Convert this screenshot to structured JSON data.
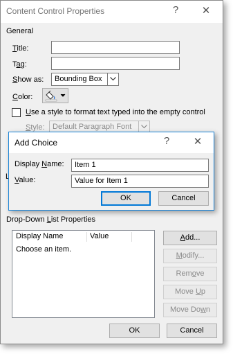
{
  "dialog": {
    "title": "Content Control Properties",
    "help_glyph": "?",
    "close_glyph": "✕",
    "general": {
      "heading": "General",
      "title_label": {
        "key": "T",
        "rest": "itle:"
      },
      "title_value": "",
      "tag_label": {
        "key": "T",
        "rest": "ag:"
      },
      "tag_value": "",
      "show_as_label": {
        "key": "S",
        "rest": "how as:"
      },
      "show_as_value": "Bounding Box",
      "color_label": {
        "key": "C",
        "rest": "olor:"
      },
      "use_style_label": {
        "key": "U",
        "rest": "se a style to format text typed into the empty control"
      },
      "use_style_checked": false,
      "style_label": {
        "key": "S",
        "rest": "tyle:"
      },
      "style_value": "Default Paragraph Font"
    },
    "partial_label": "L",
    "dropdown": {
      "heading": {
        "before": "Drop-Down ",
        "key": "L",
        "after": "ist Properties"
      },
      "columns": [
        "Display Name",
        "Value"
      ],
      "empty_text": "Choose an item.",
      "buttons": {
        "add": {
          "key": "A",
          "rest": "dd..."
        },
        "modify": {
          "key": "M",
          "rest": "odify..."
        },
        "remove": {
          "before": "Rem",
          "key": "o",
          "after": "ve"
        },
        "move_up": {
          "before": "Move ",
          "key": "U",
          "after": "p"
        },
        "move_down": {
          "before": "Move Do",
          "key": "w",
          "after": "n"
        }
      }
    },
    "ok_label": "OK",
    "cancel_label": "Cancel"
  },
  "add_choice": {
    "title": "Add Choice",
    "help_glyph": "?",
    "close_glyph": "✕",
    "display_name_label": {
      "before": "Display ",
      "key": "N",
      "after": "ame:"
    },
    "display_name_value": "Item 1",
    "value_label": {
      "key": "V",
      "rest": "alue:"
    },
    "value_value": "Value for Item 1",
    "ok_label": "OK",
    "cancel_label": "Cancel"
  },
  "colors": {
    "dialog_bg": "#f0f0f0",
    "focus_blue": "#0078d7",
    "border_gray": "#7a7a7a"
  },
  "icons": [
    "help-icon",
    "close-icon",
    "paint-bucket-icon",
    "dropdown-arrow-icon"
  ]
}
